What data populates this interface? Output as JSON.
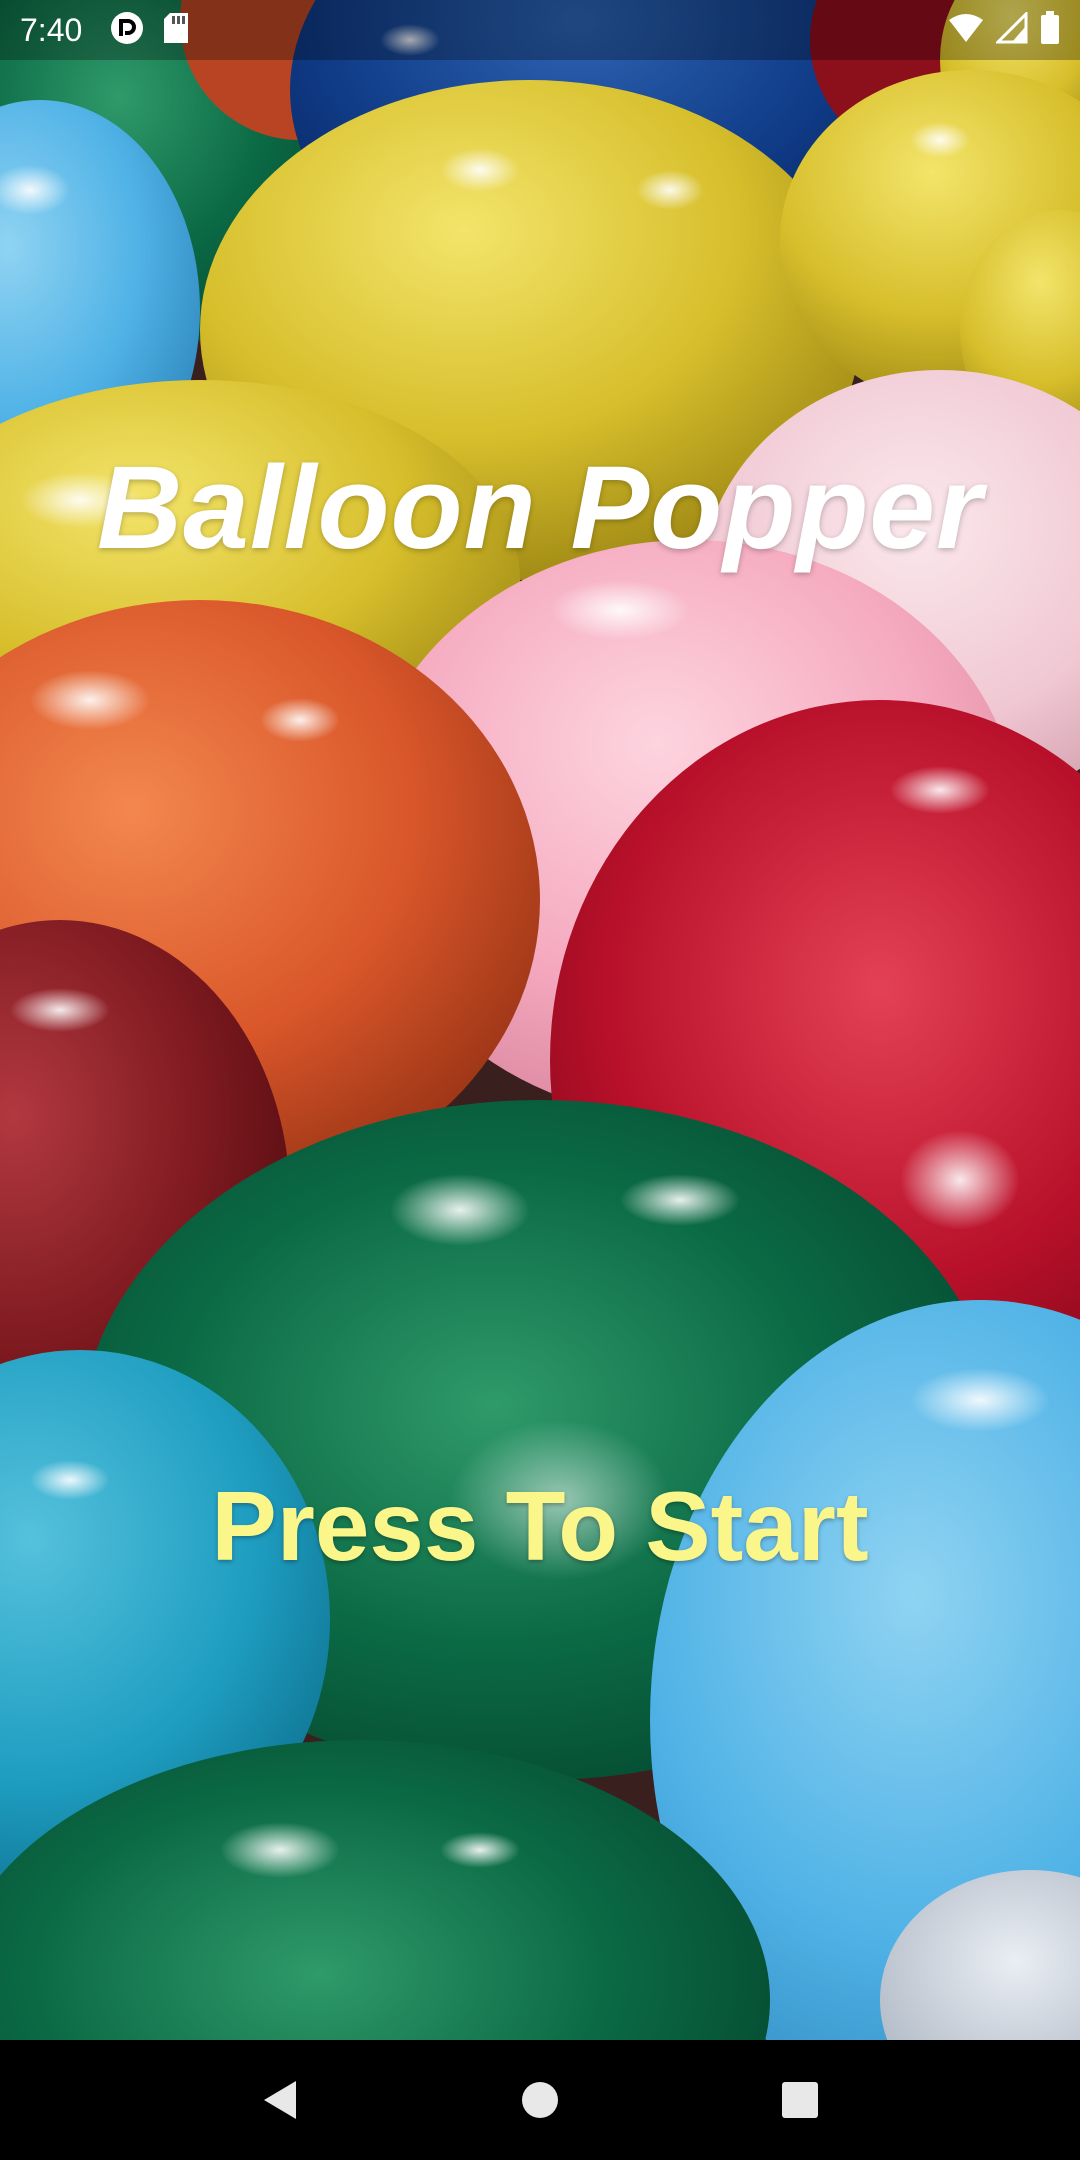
{
  "status_bar": {
    "time": "7:40",
    "left_icons": [
      "pocket-casts-icon",
      "sd-card-icon"
    ],
    "right_icons": [
      "wifi-icon",
      "cell-signal-icon",
      "battery-icon"
    ]
  },
  "game": {
    "title": "Balloon Popper",
    "start_label": "Press To Start",
    "start_color": "#fbf68a",
    "title_color": "#ffffff"
  },
  "nav_bar": {
    "buttons": [
      "back-icon",
      "home-icon",
      "recents-icon"
    ]
  }
}
